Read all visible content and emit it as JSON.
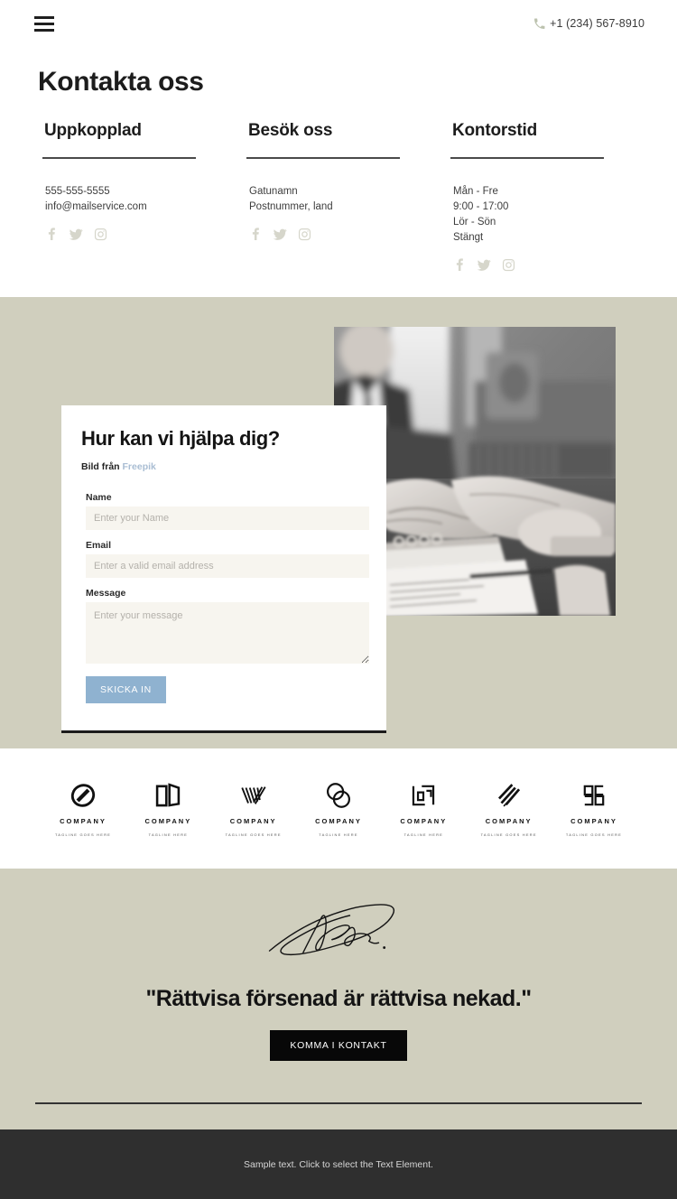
{
  "topbar": {
    "menu_icon": "hamburger-menu-icon",
    "phone_icon": "phone-icon",
    "phone": "+1 (234) 567-8910"
  },
  "header": {
    "title": "Kontakta oss"
  },
  "contact_columns": [
    {
      "title": "Uppkopplad",
      "lines": [
        "555-555-5555",
        "info@mailservice.com"
      ],
      "socials": [
        "facebook-icon",
        "twitter-icon",
        "instagram-icon"
      ]
    },
    {
      "title": "Besök oss",
      "lines": [
        "Gatunamn",
        "Postnummer, land"
      ],
      "socials": [
        "facebook-icon",
        "twitter-icon",
        "instagram-icon"
      ]
    },
    {
      "title": "Kontorstid",
      "lines": [
        "Mån - Fre",
        "9:00 - 17:00",
        "Lör - Sön",
        "Stängt"
      ],
      "socials": [
        "facebook-icon",
        "twitter-icon",
        "instagram-icon"
      ]
    }
  ],
  "form": {
    "title": "Hur kan vi hjälpa dig?",
    "credit_prefix": "Bild från",
    "credit_link": "Freepik",
    "name_label": "Name",
    "name_placeholder": "Enter your Name",
    "name_value": "",
    "email_label": "Email",
    "email_placeholder": "Enter a valid email address",
    "email_value": "",
    "message_label": "Message",
    "message_placeholder": "Enter your message",
    "message_value": "",
    "submit_label": "SKICKA IN",
    "submit_color": "#8fb2d0"
  },
  "hero_photo": {
    "alt": "handshake-photo"
  },
  "logos": [
    {
      "name": "COMPANY",
      "tagline": "TAGLINE GOES HERE",
      "mark": "ring-logo-icon"
    },
    {
      "name": "COMPANY",
      "tagline": "TAGLINE HERE",
      "mark": "book-logo-icon"
    },
    {
      "name": "COMPANY",
      "tagline": "TAGLINE GOES HERE",
      "mark": "v-lines-logo-icon"
    },
    {
      "name": "COMPANY",
      "tagline": "TAGLINE HERE",
      "mark": "two-circles-logo-icon"
    },
    {
      "name": "COMPANY",
      "tagline": "TAGLINE HERE",
      "mark": "squares-logo-icon"
    },
    {
      "name": "COMPANY",
      "tagline": "TAGLINE GOES HERE",
      "mark": "slashes-logo-icon"
    },
    {
      "name": "COMPANY",
      "tagline": "TAGLINE GOES HERE",
      "mark": "blocks-logo-icon"
    }
  ],
  "quote": {
    "signature_icon": "signature-icon",
    "text": "\"Rättvisa försenad är rättvisa nekad.\"",
    "cta_label": "KOMMA I KONTAKT"
  },
  "footer": {
    "text": "Sample text. Click to select the Text Element."
  },
  "colors": {
    "beige": "#d0cfbe",
    "dark": "#2f2f2f",
    "accent_blue": "#8fb2d0",
    "social_gray": "#d6d6cb",
    "phone_icon_green": "#bcc2ae"
  }
}
